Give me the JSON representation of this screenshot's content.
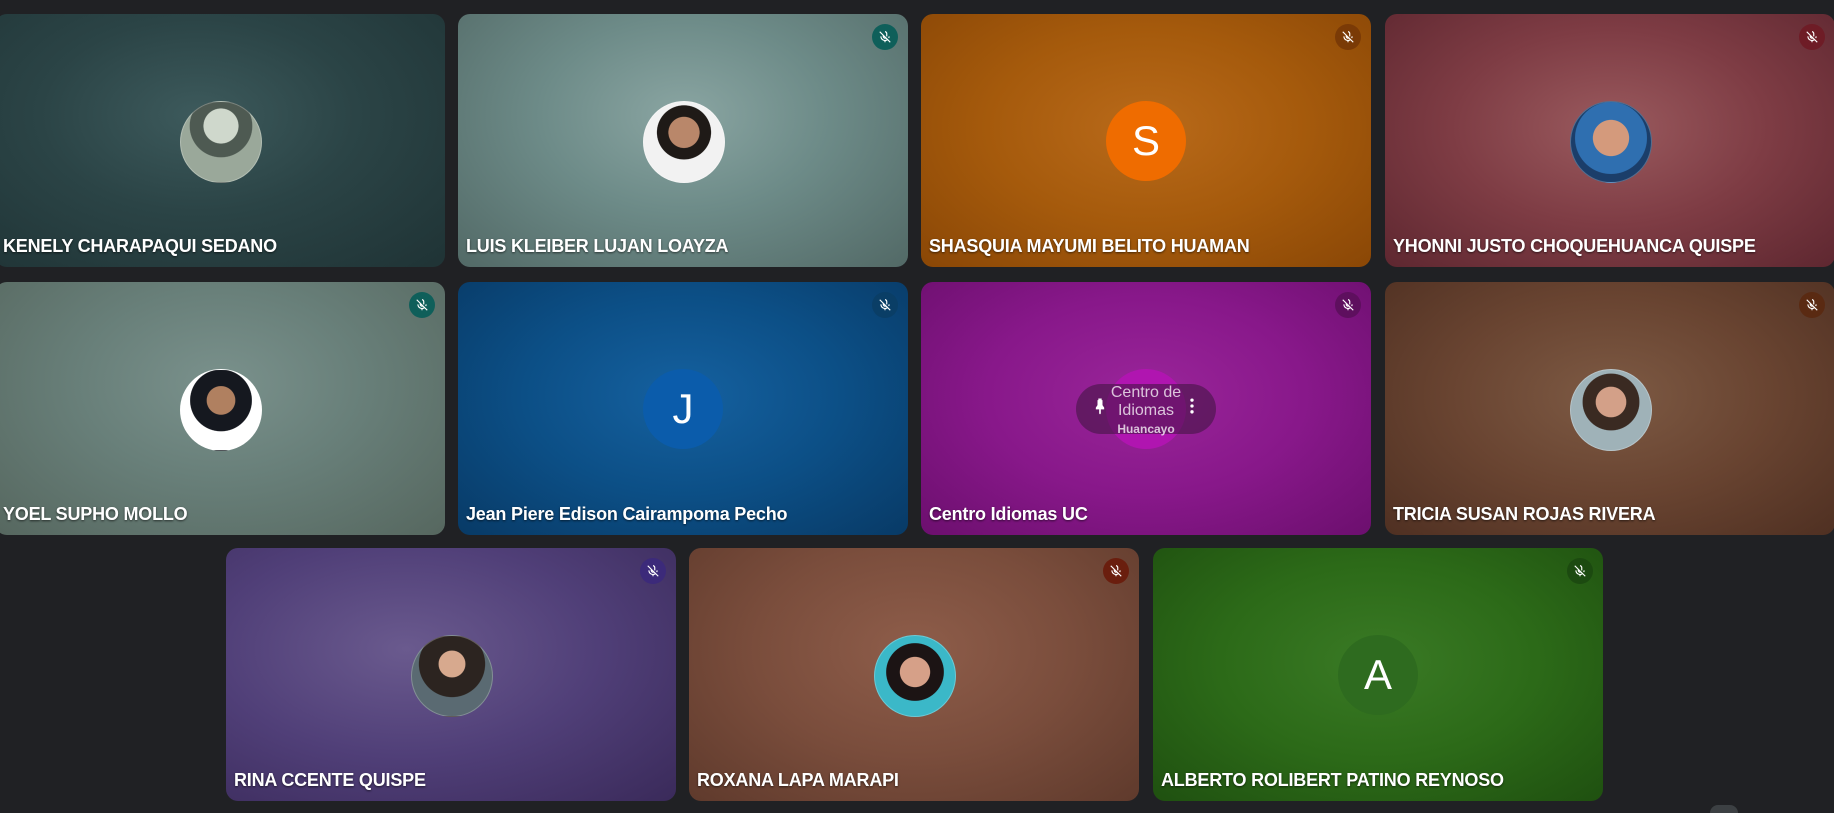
{
  "participants": [
    {
      "name": "KENELY CHARAPAQUI SEDANO",
      "avatar": "photo",
      "muted": false,
      "bg": "#2c4a4c"
    },
    {
      "name": "LUIS KLEIBER LUJAN LOAYZA",
      "avatar": "photo",
      "muted": true,
      "bg": "#6f8a88",
      "muteColor": "#0f5f5a"
    },
    {
      "name": "SHASQUIA MAYUMI BELITO HUAMAN",
      "avatar": "initial",
      "initial": "S",
      "avatarColor": "#ef6c00",
      "muted": true,
      "bg": "#a6580e",
      "muteColor": "#7a3a06"
    },
    {
      "name": "YHONNI JUSTO CHOQUEHUANCA QUISPE",
      "avatar": "photo",
      "muted": true,
      "bg": "#8a4a50",
      "muteColor": "#6e1c26"
    },
    {
      "name": "YOEL SUPHO MOLLO",
      "avatar": "photo",
      "muted": true,
      "bg": "#6b8682",
      "muteColor": "#0f5f5a"
    },
    {
      "name": "Jean Piere Edison Cairampoma Pecho",
      "avatar": "initial",
      "initial": "J",
      "avatarColor": "#0b5cab",
      "muted": true,
      "bg": "#0b4c7e",
      "muteColor": "#0a3e66"
    },
    {
      "name": "Centro Idiomas UC",
      "avatar": "logo",
      "muted": true,
      "bg": "#8d1a8c",
      "muteColor": "#5e0f5e",
      "logoText1": "Centro de",
      "logoText2": "Idiomas",
      "logoText3": "Huancayo"
    },
    {
      "name": "TRICIA SUSAN ROJAS RIVERA",
      "avatar": "photo",
      "muted": true,
      "bg": "#6e4a35",
      "muteColor": "#5a2a12"
    },
    {
      "name": "RINA CCENTE QUISPE",
      "avatar": "photo",
      "muted": true,
      "bg": "#4a3a72",
      "muteColor": "#3c2a7a"
    },
    {
      "name": "ROXANA LAPA MARAPI",
      "avatar": "photo",
      "muted": true,
      "bg": "#7d5040",
      "muteColor": "#6a1e0e"
    },
    {
      "name": "ALBERTO ROLIBERT PATINO REYNOSO",
      "avatar": "initial",
      "initial": "A",
      "avatarColor": "#2e6b1f",
      "muted": true,
      "bg": "#2c6a18",
      "muteColor": "#1c4a10"
    }
  ]
}
